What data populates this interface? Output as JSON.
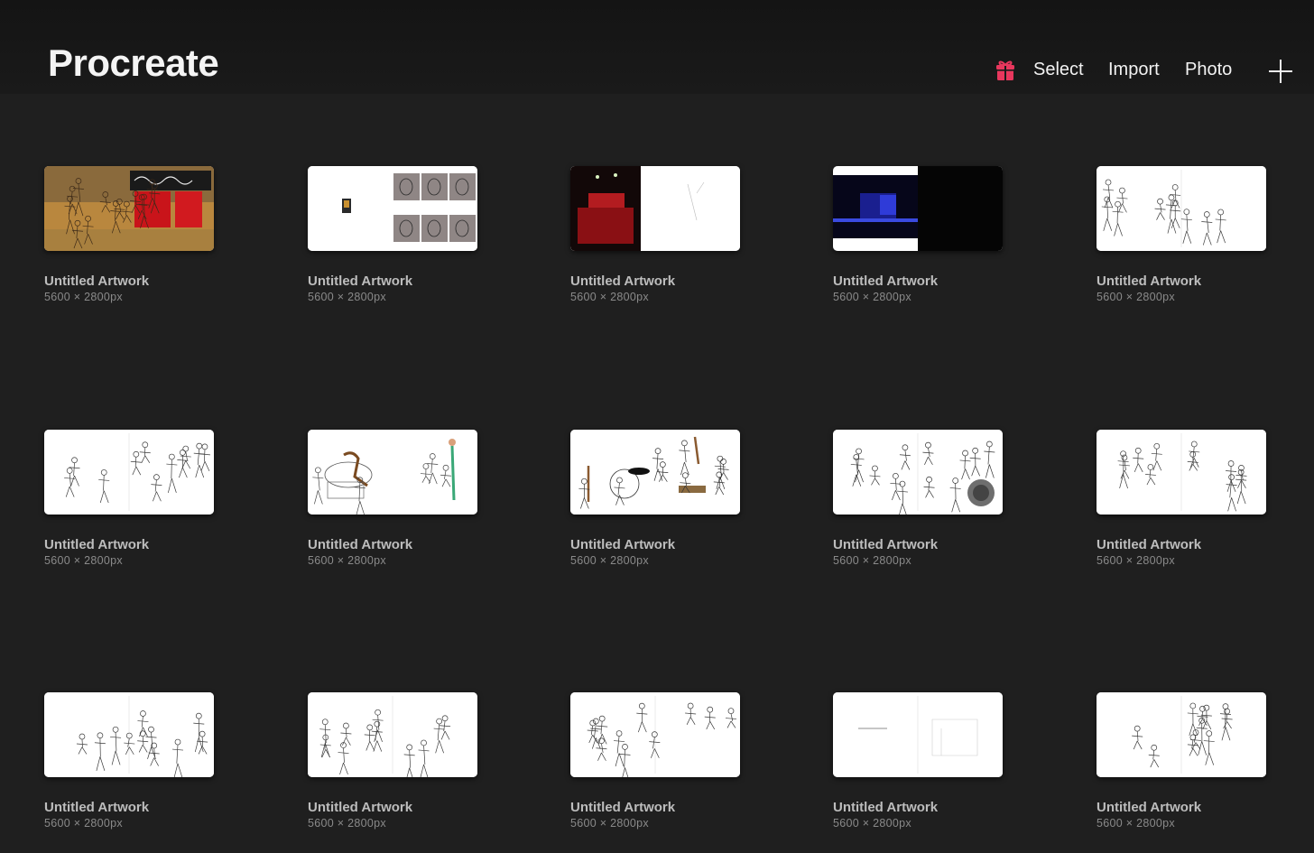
{
  "app": {
    "title": "Procreate"
  },
  "toolbar": {
    "gift_icon": "gift-icon",
    "select_label": "Select",
    "import_label": "Import",
    "photo_label": "Photo",
    "new_icon": "plus-icon",
    "accent_color": "#e8375d"
  },
  "gallery": {
    "items": [
      {
        "title": "Untitled Artwork",
        "size": "5600 × 2800px",
        "style": "street"
      },
      {
        "title": "Untitled Artwork",
        "size": "5600 × 2800px",
        "style": "portraits"
      },
      {
        "title": "Untitled Artwork",
        "size": "5600 × 2800px",
        "style": "redtheater"
      },
      {
        "title": "Untitled Artwork",
        "size": "5600 × 2800px",
        "style": "bluestage"
      },
      {
        "title": "Untitled Artwork",
        "size": "5600 × 2800px",
        "style": "sketch"
      },
      {
        "title": "Untitled Artwork",
        "size": "5600 × 2800px",
        "style": "sketch"
      },
      {
        "title": "Untitled Artwork",
        "size": "5600 × 2800px",
        "style": "colorsketch"
      },
      {
        "title": "Untitled Artwork",
        "size": "5600 × 2800px",
        "style": "colorsketch2"
      },
      {
        "title": "Untitled Artwork",
        "size": "5600 × 2800px",
        "style": "sketchcircle"
      },
      {
        "title": "Untitled Artwork",
        "size": "5600 × 2800px",
        "style": "sketch"
      },
      {
        "title": "Untitled Artwork",
        "size": "5600 × 2800px",
        "style": "sketch"
      },
      {
        "title": "Untitled Artwork",
        "size": "5600 × 2800px",
        "style": "sketch"
      },
      {
        "title": "Untitled Artwork",
        "size": "5600 × 2800px",
        "style": "sketch"
      },
      {
        "title": "Untitled Artwork",
        "size": "5600 × 2800px",
        "style": "light"
      },
      {
        "title": "Untitled Artwork",
        "size": "5600 × 2800px",
        "style": "sketch"
      }
    ]
  }
}
